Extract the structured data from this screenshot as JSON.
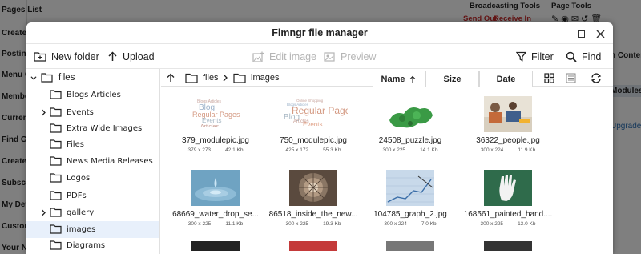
{
  "background": {
    "menu_items": [
      "Pages List",
      "Create",
      "Posting",
      "Menu G",
      "Membe",
      "Curren",
      "Find G",
      "Create",
      "Subscri",
      "My Det",
      "Custor",
      "Your N"
    ],
    "broadcasting_tools": "Broadcasting Tools",
    "send_out": "Send Out",
    "receive_in": "Receive In",
    "page_tools": "Page Tools",
    "right_texts": [
      "n Conten",
      "Modules",
      "Upgrade"
    ],
    "accent_red": "#cc2b2b",
    "accent_blue": "#2a6fb5"
  },
  "dialog": {
    "title": "Flmngr file manager"
  },
  "toolbar": {
    "new_folder": "New folder",
    "upload": "Upload",
    "edit_image": "Edit image",
    "preview": "Preview",
    "filter": "Filter",
    "find": "Find"
  },
  "tree": {
    "root": "files",
    "items": [
      {
        "label": "Blogs Articles",
        "has_children": false
      },
      {
        "label": "Events",
        "has_children": true
      },
      {
        "label": "Extra Wide Images",
        "has_children": false
      },
      {
        "label": "Files",
        "has_children": false
      },
      {
        "label": "News Media Releases",
        "has_children": false
      },
      {
        "label": "Logos",
        "has_children": false
      },
      {
        "label": "PDFs",
        "has_children": false
      },
      {
        "label": "gallery",
        "has_children": true
      },
      {
        "label": "images",
        "has_children": false,
        "selected": true
      },
      {
        "label": "Diagrams",
        "has_children": false
      }
    ]
  },
  "path": {
    "crumbs": [
      "files",
      "images"
    ]
  },
  "sort": {
    "name": "Name",
    "size": "Size",
    "date": "Date",
    "active": "Name",
    "direction": "ascending"
  },
  "files": [
    {
      "name": "379_modulepic.jpg",
      "dims": "379 x 273",
      "size": "42.1 Kb",
      "thumb": "wordcloud"
    },
    {
      "name": "750_modulepic.jpg",
      "dims": "425 x 172",
      "size": "55.3 Kb",
      "thumb": "wordcloud2"
    },
    {
      "name": "24508_puzzle.jpg",
      "dims": "300 x 225",
      "size": "14.1 Kb",
      "thumb": "puzzle"
    },
    {
      "name": "36322_people.jpg",
      "dims": "300 x 224",
      "size": "11.9 Kb",
      "thumb": "people"
    },
    {
      "name": "68669_water_drop_se...",
      "dims": "300 x 225",
      "size": "11.1 Kb",
      "thumb": "water"
    },
    {
      "name": "86518_inside_the_new...",
      "dims": "300 x 225",
      "size": "19.3 Kb",
      "thumb": "inside"
    },
    {
      "name": "104785_graph_2.jpg",
      "dims": "300 x 224",
      "size": "7.0 Kb",
      "thumb": "graph"
    },
    {
      "name": "168561_painted_hand....",
      "dims": "300 x 225",
      "size": "13.0 Kb",
      "thumb": "hand"
    }
  ],
  "wordcloud_words": [
    "Blogs Articles",
    "Blog",
    "Regular Pages",
    "Events",
    "Articles",
    "Events Calendar",
    "Media Releases"
  ],
  "wordcloud2_words": [
    "Online Shopping",
    "Blogs Articles",
    "Regular Pages",
    "Blog",
    "Articles",
    "Events",
    "Events Calendar",
    "Media Releases"
  ]
}
